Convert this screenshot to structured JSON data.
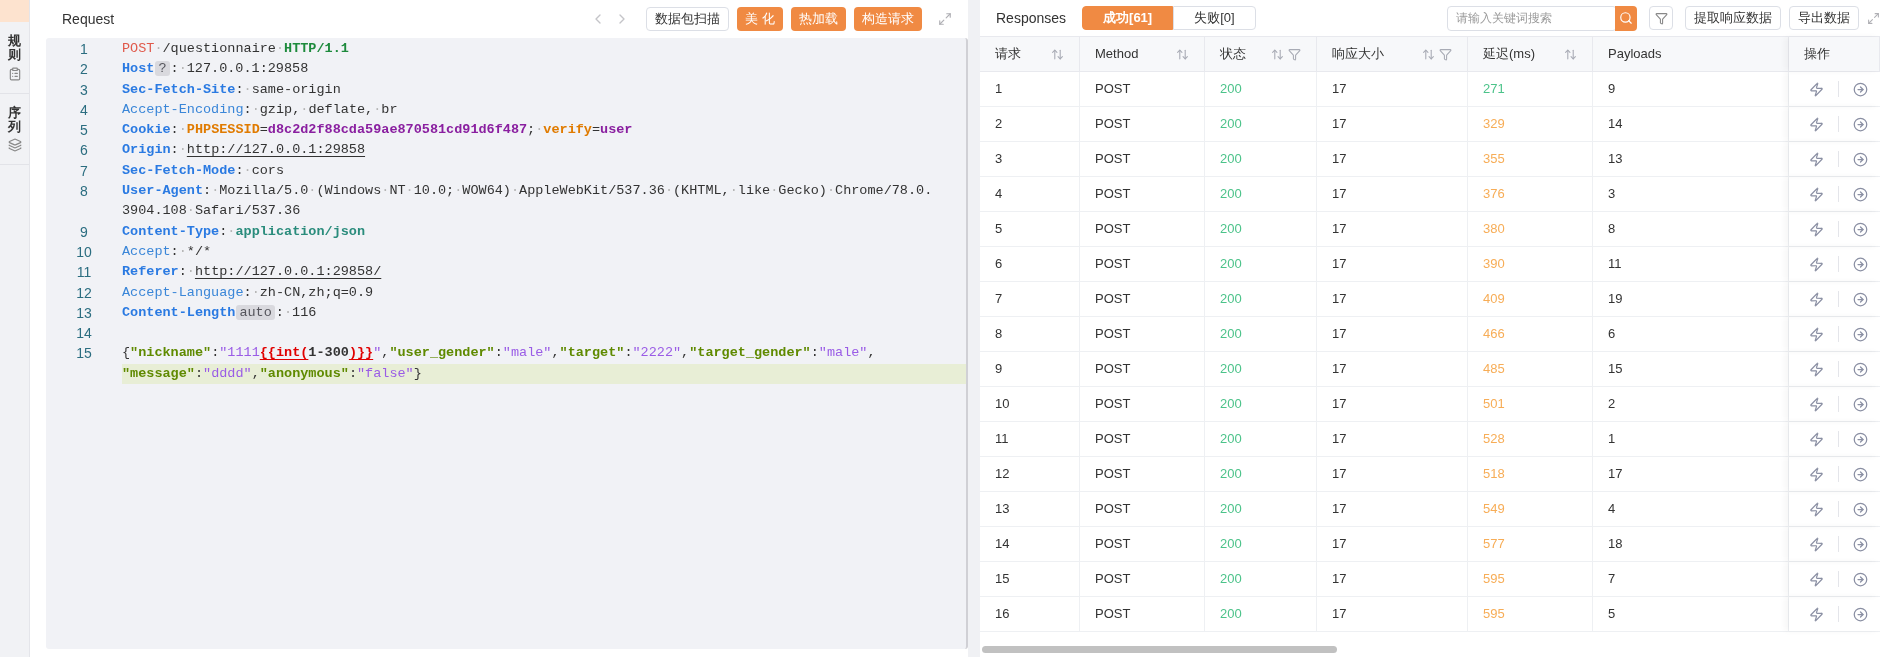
{
  "sidebar": {
    "tabs": [
      {
        "label": "规则"
      },
      {
        "label": "序列"
      }
    ]
  },
  "request": {
    "title": "Request",
    "buttons": [
      {
        "label": "数据包扫描",
        "kind": "outline"
      },
      {
        "label": "美 化",
        "kind": "primary"
      },
      {
        "label": "热加载",
        "kind": "primary"
      },
      {
        "label": "构造请求",
        "kind": "primary"
      }
    ],
    "lines": [
      {
        "number": "1",
        "rows": [
          {
            "highlighted": false,
            "tokens": [
              {
                "text": "POST",
                "kind": "method"
              },
              {
                "text": "·",
                "kind": "space"
              },
              {
                "text": "/questionnaire",
                "kind": "plain"
              },
              {
                "text": "·",
                "kind": "space"
              },
              {
                "text": "HTTP/1.1",
                "kind": "version"
              }
            ]
          }
        ]
      },
      {
        "number": "2",
        "rows": [
          {
            "highlighted": false,
            "tokens": [
              {
                "text": "Host",
                "kind": "hname"
              },
              {
                "text": "?",
                "kind": "tag"
              },
              {
                "text": ":",
                "kind": "plain"
              },
              {
                "text": "·",
                "kind": "space"
              },
              {
                "text": "127.0.0.1:29858",
                "kind": "plain"
              }
            ]
          }
        ]
      },
      {
        "number": "3",
        "rows": [
          {
            "highlighted": false,
            "tokens": [
              {
                "text": "Sec-Fetch-Site",
                "kind": "hname"
              },
              {
                "text": ":",
                "kind": "plain"
              },
              {
                "text": "·",
                "kind": "space"
              },
              {
                "text": "same-origin",
                "kind": "plain"
              }
            ]
          }
        ]
      },
      {
        "number": "4",
        "rows": [
          {
            "highlighted": false,
            "tokens": [
              {
                "text": "Accept-Encoding",
                "kind": "hname2"
              },
              {
                "text": ":",
                "kind": "plain"
              },
              {
                "text": "·",
                "kind": "space"
              },
              {
                "text": "gzip,",
                "kind": "plain"
              },
              {
                "text": "·",
                "kind": "space"
              },
              {
                "text": "deflate,",
                "kind": "plain"
              },
              {
                "text": "·",
                "kind": "space"
              },
              {
                "text": "br",
                "kind": "plain"
              }
            ]
          }
        ]
      },
      {
        "number": "5",
        "rows": [
          {
            "highlighted": false,
            "tokens": [
              {
                "text": "Cookie",
                "kind": "hname"
              },
              {
                "text": ":",
                "kind": "plain"
              },
              {
                "text": "·",
                "kind": "space"
              },
              {
                "text": "PHPSESSID",
                "kind": "ckey"
              },
              {
                "text": "=",
                "kind": "plain"
              },
              {
                "text": "d8c2d2f88cda59ae870581cd91d6f487",
                "kind": "cval"
              },
              {
                "text": ";",
                "kind": "plain"
              },
              {
                "text": "·",
                "kind": "space"
              },
              {
                "text": "verify",
                "kind": "ckey"
              },
              {
                "text": "=",
                "kind": "plain"
              },
              {
                "text": "user",
                "kind": "cval"
              }
            ]
          }
        ]
      },
      {
        "number": "6",
        "rows": [
          {
            "highlighted": false,
            "tokens": [
              {
                "text": "Origin",
                "kind": "hname"
              },
              {
                "text": ":",
                "kind": "plain"
              },
              {
                "text": "·",
                "kind": "space"
              },
              {
                "text": "http://127.0.0.1:29858",
                "kind": "url"
              }
            ]
          }
        ]
      },
      {
        "number": "7",
        "rows": [
          {
            "highlighted": false,
            "tokens": [
              {
                "text": "Sec-Fetch-Mode",
                "kind": "hname"
              },
              {
                "text": ":",
                "kind": "plain"
              },
              {
                "text": "·",
                "kind": "space"
              },
              {
                "text": "cors",
                "kind": "plain"
              }
            ]
          }
        ]
      },
      {
        "number": "8",
        "rows": [
          {
            "highlighted": false,
            "tokens": [
              {
                "text": "User-Agent",
                "kind": "hname"
              },
              {
                "text": ":",
                "kind": "plain"
              },
              {
                "text": "·",
                "kind": "space"
              },
              {
                "text": "Mozilla/5.0",
                "kind": "plain"
              },
              {
                "text": "·",
                "kind": "space"
              },
              {
                "text": "(Windows",
                "kind": "plain"
              },
              {
                "text": "·",
                "kind": "space"
              },
              {
                "text": "NT",
                "kind": "plain"
              },
              {
                "text": "·",
                "kind": "space"
              },
              {
                "text": "10.0;",
                "kind": "plain"
              },
              {
                "text": "·",
                "kind": "space"
              },
              {
                "text": "WOW64)",
                "kind": "plain"
              },
              {
                "text": "·",
                "kind": "space"
              },
              {
                "text": "AppleWebKit/537.36",
                "kind": "plain"
              },
              {
                "text": "·",
                "kind": "space"
              },
              {
                "text": "(KHTML,",
                "kind": "plain"
              },
              {
                "text": "·",
                "kind": "space"
              },
              {
                "text": "like",
                "kind": "plain"
              },
              {
                "text": "·",
                "kind": "space"
              },
              {
                "text": "Gecko)",
                "kind": "plain"
              },
              {
                "text": "·",
                "kind": "space"
              },
              {
                "text": "Chrome/78.0.",
                "kind": "plain"
              }
            ]
          },
          {
            "highlighted": false,
            "tokens": [
              {
                "text": "3904.108",
                "kind": "plain"
              },
              {
                "text": "·",
                "kind": "space"
              },
              {
                "text": "Safari/537.36",
                "kind": "plain"
              }
            ]
          }
        ]
      },
      {
        "number": "9",
        "rows": [
          {
            "highlighted": false,
            "tokens": [
              {
                "text": "Content-Type",
                "kind": "hname"
              },
              {
                "text": ":",
                "kind": "plain"
              },
              {
                "text": "·",
                "kind": "space"
              },
              {
                "text": "application/json",
                "kind": "jval"
              }
            ]
          }
        ]
      },
      {
        "number": "10",
        "rows": [
          {
            "highlighted": false,
            "tokens": [
              {
                "text": "Accept",
                "kind": "hname2"
              },
              {
                "text": ":",
                "kind": "plain"
              },
              {
                "text": "·",
                "kind": "space"
              },
              {
                "text": "*/*",
                "kind": "plain"
              }
            ]
          }
        ]
      },
      {
        "number": "11",
        "rows": [
          {
            "highlighted": false,
            "tokens": [
              {
                "text": "Referer",
                "kind": "hname"
              },
              {
                "text": ":",
                "kind": "plain"
              },
              {
                "text": "·",
                "kind": "space"
              },
              {
                "text": "http://127.0.0.1:29858/",
                "kind": "url"
              }
            ]
          }
        ]
      },
      {
        "number": "12",
        "rows": [
          {
            "highlighted": false,
            "tokens": [
              {
                "text": "Accept-Language",
                "kind": "hname2"
              },
              {
                "text": ":",
                "kind": "plain"
              },
              {
                "text": "·",
                "kind": "space"
              },
              {
                "text": "zh-CN,zh;q=0.9",
                "kind": "plain"
              }
            ]
          }
        ]
      },
      {
        "number": "13",
        "rows": [
          {
            "highlighted": false,
            "tokens": [
              {
                "text": "Content-Length",
                "kind": "hname"
              },
              {
                "text": "auto",
                "kind": "tag"
              },
              {
                "text": ":",
                "kind": "plain"
              },
              {
                "text": "·",
                "kind": "space"
              },
              {
                "text": "116",
                "kind": "plain"
              }
            ]
          }
        ]
      },
      {
        "number": "14"
      },
      {
        "number": "15",
        "rows": [
          {
            "highlighted": false,
            "tokens": [
              {
                "text": "{",
                "kind": "plain"
              },
              {
                "text": "\"nickname\"",
                "kind": "jkey"
              },
              {
                "text": ":",
                "kind": "plain"
              },
              {
                "text": "\"1111",
                "kind": "jstr"
              },
              {
                "text": "{{int(",
                "kind": "fuzz"
              },
              {
                "text": "1-300",
                "kind": "fuzzarg"
              },
              {
                "text": ")}}",
                "kind": "fuzz"
              },
              {
                "text": "\"",
                "kind": "jstr"
              },
              {
                "text": ",",
                "kind": "plain"
              },
              {
                "text": "\"user_gender\"",
                "kind": "jkey"
              },
              {
                "text": ":",
                "kind": "plain"
              },
              {
                "text": "\"male\"",
                "kind": "jstr"
              },
              {
                "text": ",",
                "kind": "plain"
              },
              {
                "text": "\"target\"",
                "kind": "jkey"
              },
              {
                "text": ":",
                "kind": "plain"
              },
              {
                "text": "\"2222\"",
                "kind": "jstr"
              },
              {
                "text": ",",
                "kind": "plain"
              },
              {
                "text": "\"target_gender\"",
                "kind": "jkey"
              },
              {
                "text": ":",
                "kind": "plain"
              },
              {
                "text": "\"male\"",
                "kind": "jstr"
              },
              {
                "text": ",",
                "kind": "plain"
              }
            ]
          },
          {
            "highlighted": true,
            "tokens": [
              {
                "text": "\"message\"",
                "kind": "jkey"
              },
              {
                "text": ":",
                "kind": "plain"
              },
              {
                "text": "\"dddd\"",
                "kind": "jstr"
              },
              {
                "text": ",",
                "kind": "plain"
              },
              {
                "text": "\"anonymous\"",
                "kind": "jkey"
              },
              {
                "text": ":",
                "kind": "plain"
              },
              {
                "text": "\"false\"",
                "kind": "jstr"
              },
              {
                "text": "}",
                "kind": "plain"
              }
            ]
          }
        ]
      }
    ]
  },
  "responses": {
    "title": "Responses",
    "tabs": [
      {
        "label": "成功[61]",
        "selected": true
      },
      {
        "label": "失败[0]",
        "selected": false
      }
    ],
    "search": {
      "placeholder": "请输入关键词搜索"
    },
    "buttons": [
      "提取响应数据",
      "导出数据"
    ],
    "columns": [
      {
        "label": "请求",
        "sortable": true,
        "filterable": false
      },
      {
        "label": "Method",
        "sortable": true,
        "filterable": false
      },
      {
        "label": "状态",
        "sortable": true,
        "filterable": true
      },
      {
        "label": "响应大小",
        "sortable": true,
        "filterable": true
      },
      {
        "label": "延迟(ms)",
        "sortable": true,
        "filterable": false
      },
      {
        "label": "Payloads",
        "sortable": false,
        "filterable": false
      },
      {
        "label": "操作",
        "sortable": false,
        "filterable": false
      }
    ],
    "rows": [
      {
        "id": "1",
        "method": "POST",
        "status": "200",
        "size": "17",
        "latency": "271",
        "color": "#4cc38a",
        "payload": "9"
      },
      {
        "id": "2",
        "method": "POST",
        "status": "200",
        "size": "17",
        "latency": "329",
        "color": "#f7ad57",
        "payload": "14"
      },
      {
        "id": "3",
        "method": "POST",
        "status": "200",
        "size": "17",
        "latency": "355",
        "color": "#f7ad57",
        "payload": "13"
      },
      {
        "id": "4",
        "method": "POST",
        "status": "200",
        "size": "17",
        "latency": "376",
        "color": "#f7ad57",
        "payload": "3"
      },
      {
        "id": "5",
        "method": "POST",
        "status": "200",
        "size": "17",
        "latency": "380",
        "color": "#f7ad57",
        "payload": "8"
      },
      {
        "id": "6",
        "method": "POST",
        "status": "200",
        "size": "17",
        "latency": "390",
        "color": "#f7ad57",
        "payload": "11"
      },
      {
        "id": "7",
        "method": "POST",
        "status": "200",
        "size": "17",
        "latency": "409",
        "color": "#f7ad57",
        "payload": "19"
      },
      {
        "id": "8",
        "method": "POST",
        "status": "200",
        "size": "17",
        "latency": "466",
        "color": "#f7ad57",
        "payload": "6"
      },
      {
        "id": "9",
        "method": "POST",
        "status": "200",
        "size": "17",
        "latency": "485",
        "color": "#f7ad57",
        "payload": "15"
      },
      {
        "id": "10",
        "method": "POST",
        "status": "200",
        "size": "17",
        "latency": "501",
        "color": "#f7ad57",
        "payload": "2"
      },
      {
        "id": "11",
        "method": "POST",
        "status": "200",
        "size": "17",
        "latency": "528",
        "color": "#f7ad57",
        "payload": "1"
      },
      {
        "id": "12",
        "method": "POST",
        "status": "200",
        "size": "17",
        "latency": "518",
        "color": "#f7ad57",
        "payload": "17"
      },
      {
        "id": "13",
        "method": "POST",
        "status": "200",
        "size": "17",
        "latency": "549",
        "color": "#f7ad57",
        "payload": "4"
      },
      {
        "id": "14",
        "method": "POST",
        "status": "200",
        "size": "17",
        "latency": "577",
        "color": "#f7ad57",
        "payload": "18"
      },
      {
        "id": "15",
        "method": "POST",
        "status": "200",
        "size": "17",
        "latency": "595",
        "color": "#f7ad57",
        "payload": "7"
      },
      {
        "id": "16",
        "method": "POST",
        "status": "200",
        "size": "17",
        "latency": "595",
        "color": "#f7ad57",
        "payload": "5"
      }
    ]
  }
}
